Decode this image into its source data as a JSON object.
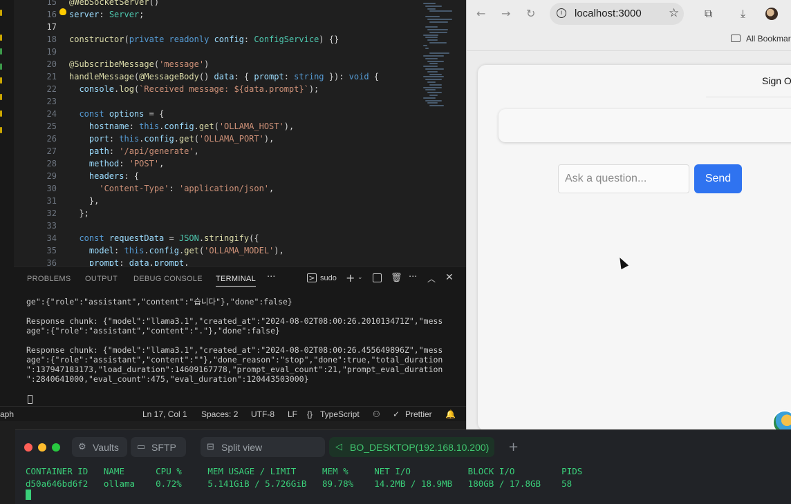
{
  "editor": {
    "line_numbers": [
      "15",
      "16",
      "17",
      "18",
      "19",
      "20",
      "21",
      "22",
      "23",
      "24",
      "25",
      "26",
      "27",
      "28",
      "29",
      "30",
      "31",
      "32",
      "33",
      "34",
      "35",
      "36"
    ],
    "current_line": "17",
    "lines": [
      "@WebSocketServer()",
      "server: Server;",
      "",
      "constructor(private readonly config: ConfigService) {}",
      "",
      "@SubscribeMessage('message')",
      "handleMessage(@MessageBody() data: { prompt: string }): void {",
      "  console.log(`Received message: ${data.prompt}`);",
      "",
      "  const options = {",
      "    hostname: this.config.get('OLLAMA_HOST'),",
      "    port: this.config.get('OLLAMA_PORT'),",
      "    path: '/api/generate',",
      "    method: 'POST',",
      "    headers: {",
      "      'Content-Type': 'application/json',",
      "    },",
      "  };",
      "",
      "  const requestData = JSON.stringify({",
      "    model: this.config.get('OLLAMA_MODEL'),",
      "    prompt: data.prompt,"
    ]
  },
  "panel": {
    "tabs": [
      "PROBLEMS",
      "OUTPUT",
      "DEBUG CONSOLE",
      "TERMINAL"
    ],
    "more": "···",
    "shell_label": "sudo",
    "terminal_lines": [
      "ge\":{\"role\":\"assistant\",\"content\":\"습니다\"},\"done\":false}",
      "",
      "Response chunk: {\"model\":\"llama3.1\",\"created_at\":\"2024-08-02T08:00:26.201013471Z\",\"mess",
      "age\":{\"role\":\"assistant\",\"content\":\".\"},\"done\":false}",
      "",
      "Response chunk: {\"model\":\"llama3.1\",\"created_at\":\"2024-08-02T08:00:26.455649896Z\",\"mess",
      "age\":{\"role\":\"assistant\",\"content\":\"\"},\"done_reason\":\"stop\",\"done\":true,\"total_duration",
      "\":137947183173,\"load_duration\":14609167778,\"prompt_eval_count\":21,\"prompt_eval_duration",
      "\":2840641000,\"eval_count\":475,\"eval_duration\":120443503000}"
    ]
  },
  "statusbar": {
    "left_fragment": "aph",
    "position": "Ln 17, Col 1",
    "spaces": "Spaces: 2",
    "encoding": "UTF-8",
    "eol": "LF",
    "language": "TypeScript",
    "formatter": "Prettier"
  },
  "browser": {
    "url": "localhost:3000",
    "bookmarks_label": "All Bookmarks",
    "sign_out": "Sign Out",
    "input_placeholder": "Ask a question...",
    "send_label": "Send"
  },
  "terminal_app": {
    "tabs": [
      "Vaults",
      "SFTP",
      "Split view",
      "BO_DESKTOP(192.168.10.200)"
    ],
    "stats_header": "CONTAINER ID   NAME      CPU %     MEM USAGE / LIMIT     MEM %     NET I/O           BLOCK I/O         PIDS",
    "stats_row": "d50a646bd6f2   ollama    0.72%     5.141GiB / 5.726GiB   89.78%    14.2MB / 18.9MB   180GB / 17.8GB    58"
  },
  "colors": {
    "send_button": "#2f73f0",
    "terminal_green": "#3ad07a",
    "editor_bg": "#1f1f1f"
  }
}
